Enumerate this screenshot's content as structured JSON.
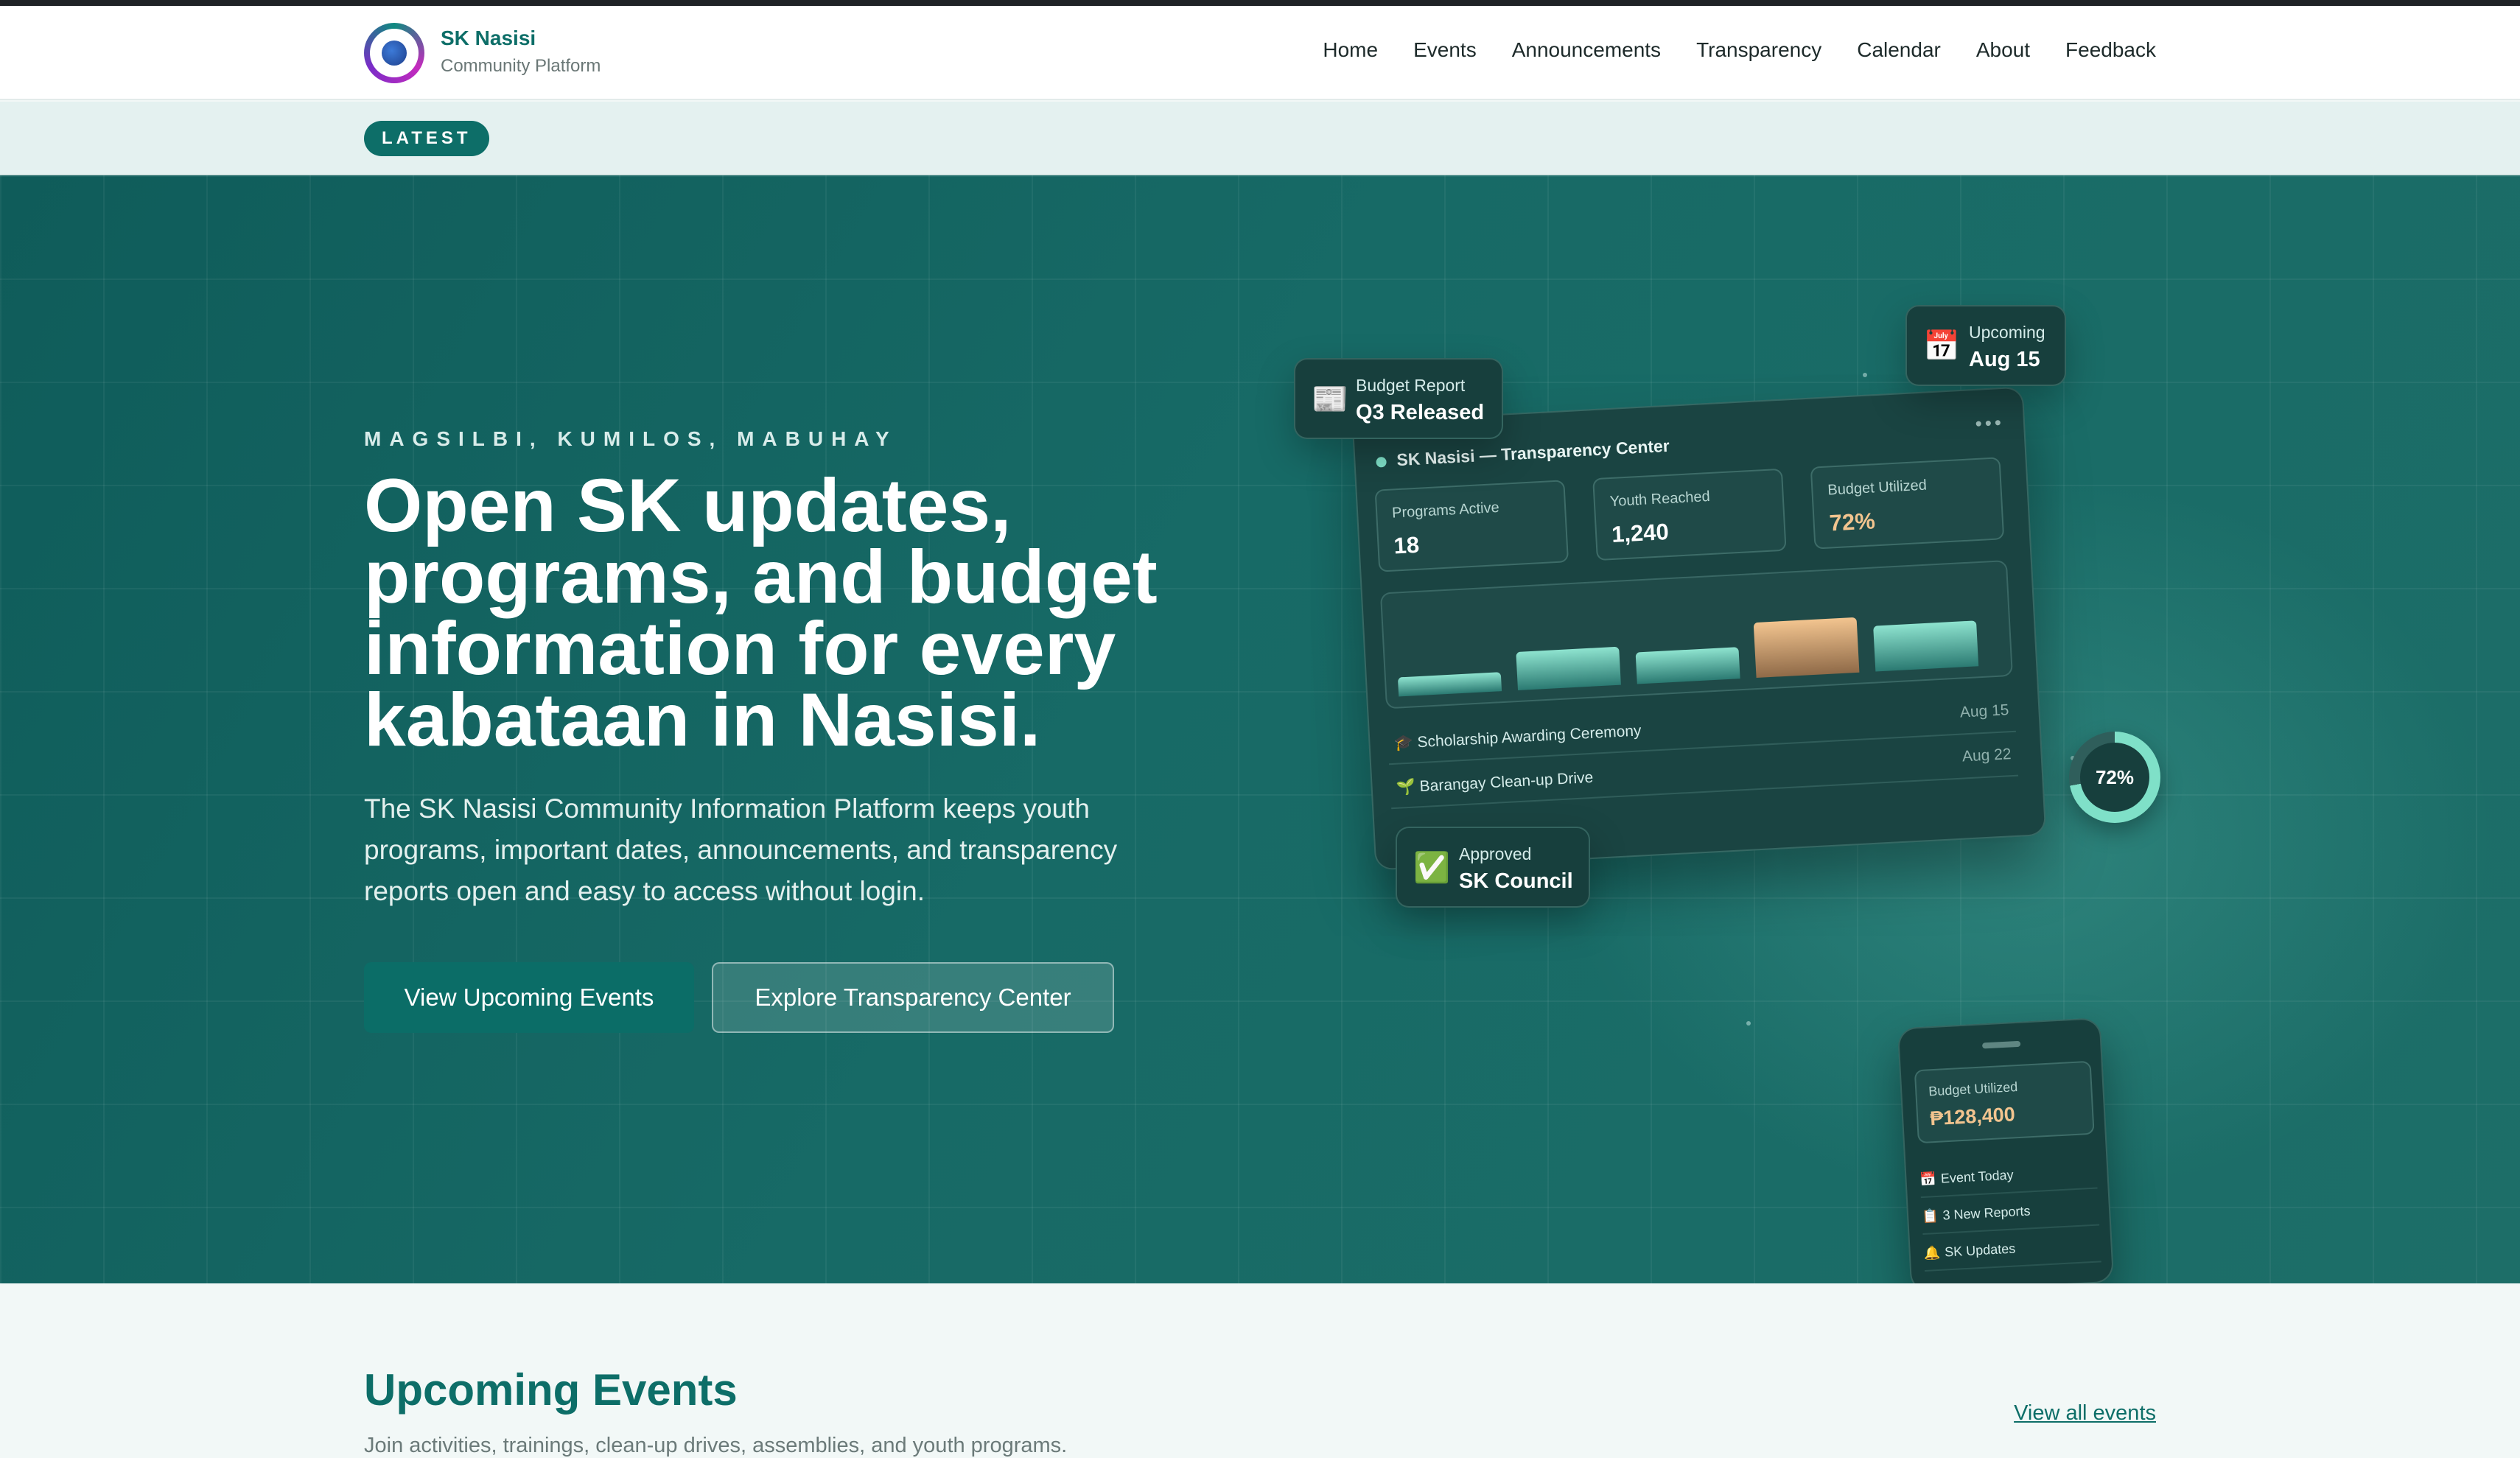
{
  "brand": {
    "name": "SK Nasisi",
    "subtitle": "Community Platform"
  },
  "nav": {
    "items": [
      "Home",
      "Events",
      "Announcements",
      "Transparency",
      "Calendar",
      "About",
      "Feedback"
    ]
  },
  "latest": {
    "label": "LATEST"
  },
  "hero": {
    "tagline": "MAGSILBI, KUMILOS, MABUHAY",
    "headline": "Open SK updates, programs, and budget information for every kabataan in Nasisi.",
    "description": "The SK Nasisi Community Information Platform keeps youth programs, important dates, announcements, and transparency reports open and easy to access without login.",
    "primary_button": "View Upcoming Events",
    "secondary_button": "Explore Transparency Center"
  },
  "floating_cards": {
    "budget_report": {
      "icon": "📰",
      "label": "Budget Report",
      "value": "Q3 Released"
    },
    "upcoming": {
      "icon": "📅",
      "label": "Upcoming",
      "value": "Aug 15"
    },
    "approved": {
      "icon": "✅",
      "label": "Approved",
      "value": "SK Council"
    }
  },
  "dashboard": {
    "title": "SK Nasisi — Transparency Center",
    "menu": "•••",
    "stats": [
      {
        "label": "Programs Active",
        "value": "18"
      },
      {
        "label": "Youth Reached",
        "value": "1,240"
      },
      {
        "label": "Budget Utilized",
        "value": "72%",
        "color": "#f2c48f"
      }
    ],
    "chart_levels": [
      0.2,
      0.4,
      0.33,
      0.58,
      0.48
    ],
    "highlight_index": 3,
    "events": [
      {
        "icon": "🎓",
        "title": "Scholarship Awarding Ceremony",
        "date": "Aug 15"
      },
      {
        "icon": "🌱",
        "title": "Barangay Clean-up Drive",
        "date": "Aug 22"
      }
    ]
  },
  "ring": {
    "label": "72%",
    "fraction": 0.72
  },
  "phone": {
    "stat_label": "Budget Utilized",
    "stat_value": "₱128,400",
    "rows": [
      {
        "icon": "📅",
        "label": "Event Today"
      },
      {
        "icon": "📋",
        "label": "3 New Reports"
      },
      {
        "icon": "🔔",
        "label": "SK Updates"
      }
    ]
  },
  "events_section": {
    "title": "Upcoming Events",
    "subtitle": "Join activities, trainings, clean-up drives, assemblies, and youth programs.",
    "view_all": "View all events"
  },
  "colors": {
    "brand": "#0d6e68",
    "hero": "#176a66",
    "accent": "#7fe0c8",
    "highlight": "#f2c48f"
  }
}
